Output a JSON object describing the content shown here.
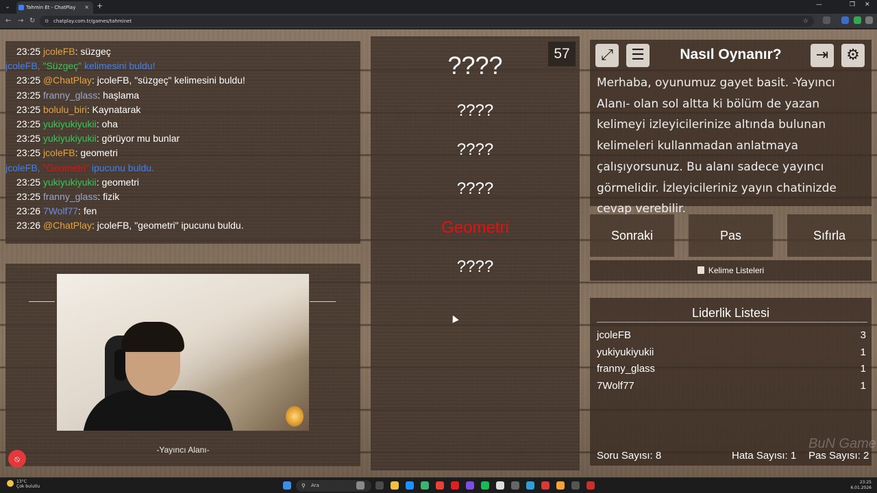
{
  "browser": {
    "tab_title": "Tahmin Et - ChatPlay",
    "tab_close": "×",
    "new_tab": "+",
    "url": "chatplay.com.tr/games/tahminet",
    "window_controls": [
      "—",
      "❐",
      "✕"
    ]
  },
  "chat": {
    "messages": [
      {
        "time": "23:25",
        "user": "jcoleFB",
        "user_color": "#e8a33a",
        "text": ": süzgeç"
      },
      {
        "system": true,
        "pre": "jcoleFB, ",
        "highlight": "\"Süzgeç\"",
        "highlight_color": "#34c759",
        "post": " kelimesini buldu!"
      },
      {
        "time": "23:25",
        "user": "@ChatPlay",
        "user_color": "#e8a33a",
        "text": ": jcoleFB, \"süzgeç\" kelimesini buldu!"
      },
      {
        "time": "23:25",
        "user": "franny_glass",
        "user_color": "#9aa7c7",
        "text": ": haşlama"
      },
      {
        "time": "23:25",
        "user": "bolulu_biri",
        "user_color": "#e8a33a",
        "text": ": Kaynatarak"
      },
      {
        "time": "23:25",
        "user": "yukiyukiyukii",
        "user_color": "#34c759",
        "text": ": oha"
      },
      {
        "time": "23:25",
        "user": "yukiyukiyukii",
        "user_color": "#34c759",
        "text": ": görüyor mu bunlar"
      },
      {
        "time": "23:25",
        "user": "jcoleFB",
        "user_color": "#e8a33a",
        "text": ": geometri"
      },
      {
        "system": true,
        "pre": "jcoleFB, ",
        "highlight": "\"Geometri\"",
        "highlight_color": "#e01212",
        "post": " ipucunu buldu."
      },
      {
        "time": "23:25",
        "user": "yukiyukiyukii",
        "user_color": "#34c759",
        "text": ": geometri"
      },
      {
        "time": "23:25",
        "user": "franny_glass",
        "user_color": "#9aa7c7",
        "text": ": fizik"
      },
      {
        "time": "23:26",
        "user": "7Wolf77",
        "user_color": "#6b8de8",
        "text": ": fen"
      },
      {
        "time": "23:26",
        "user": "@ChatPlay",
        "user_color": "#e8a33a",
        "text": ": jcoleFB, \"geometri\" ipucunu buldu."
      }
    ]
  },
  "streamer_area": {
    "label": "-Yayıncı Alanı-"
  },
  "game": {
    "timer": "57",
    "main_word": "????",
    "hints": [
      "????",
      "????",
      "????",
      "Geometri",
      "????"
    ],
    "revealed_hint_color": "#e01212"
  },
  "howto": {
    "title": "Nasıl Oynanır?",
    "text": "Merhaba, oyunumuz gayet basit. -Yayıncı Alanı- olan sol altta ki bölüm de yazan kelimeyi izleyicilerinize altında bulunan kelimeleri kullanmadan anlatmaya çalışıyorsunuz. Bu alanı sadece yayıncı görmelidir. İzleyicileriniz yayın chatinizde cevap verebilir.",
    "icons": [
      "fullscreen-icon",
      "list-icon",
      "exit-icon",
      "settings-icon"
    ]
  },
  "controls": {
    "next": "Sonraki",
    "pass": "Pas",
    "reset": "Sıfırla",
    "word_lists": "Kelime Listeleri"
  },
  "leaderboard": {
    "title": "Liderlik Listesi",
    "rows": [
      {
        "name": "jcoleFB",
        "score": "3"
      },
      {
        "name": "yukiyukiyukii",
        "score": "1"
      },
      {
        "name": "franny_glass",
        "score": "1"
      },
      {
        "name": "7Wolf77",
        "score": "1"
      }
    ],
    "question_count_label": "Soru Sayısı: 8",
    "error_count_label": "Hata Sayısı: 1",
    "pass_count_label": "Pas Sayısı: 2"
  },
  "taskbar": {
    "weather_temp": "13°C",
    "weather_desc": "Çok bulutlu",
    "search_placeholder": "Ara",
    "time": "23:25",
    "date": "6.01.2026"
  }
}
